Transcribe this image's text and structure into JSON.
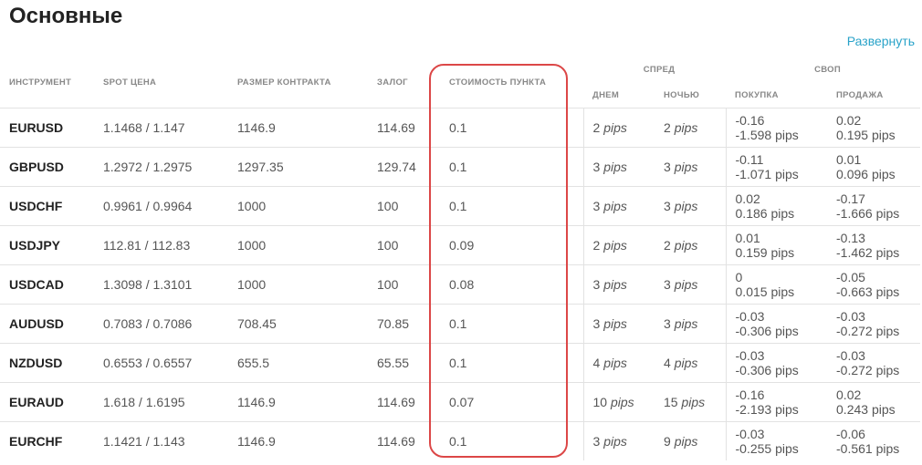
{
  "page": {
    "title": "Основные",
    "expand_link": "Развернуть"
  },
  "table": {
    "headers": {
      "instrument": "Инструмент",
      "spot": "Spot цена",
      "contract": "Размер контракта",
      "margin": "Залог",
      "point_cost": "Стоимость пункта",
      "spread": "Спред",
      "spread_day": "Днем",
      "spread_night": "Ночью",
      "swap": "Своп",
      "swap_buy": "Покупка",
      "swap_sell": "Продажа"
    },
    "rows": [
      {
        "symbol": "EURUSD",
        "spot": "1.1468 / 1.147",
        "contract": "1146.9",
        "margin": "114.69",
        "point": "0.1",
        "day": "2",
        "night": "2",
        "buy1": "-0.16",
        "buy2": "-1.598 pips",
        "sell1": "0.02",
        "sell2": "0.195 pips"
      },
      {
        "symbol": "GBPUSD",
        "spot": "1.2972 / 1.2975",
        "contract": "1297.35",
        "margin": "129.74",
        "point": "0.1",
        "day": "3",
        "night": "3",
        "buy1": "-0.11",
        "buy2": "-1.071 pips",
        "sell1": "0.01",
        "sell2": "0.096 pips"
      },
      {
        "symbol": "USDCHF",
        "spot": "0.9961 / 0.9964",
        "contract": "1000",
        "margin": "100",
        "point": "0.1",
        "day": "3",
        "night": "3",
        "buy1": "0.02",
        "buy2": "0.186 pips",
        "sell1": "-0.17",
        "sell2": "-1.666 pips"
      },
      {
        "symbol": "USDJPY",
        "spot": "112.81 / 112.83",
        "contract": "1000",
        "margin": "100",
        "point": "0.09",
        "day": "2",
        "night": "2",
        "buy1": "0.01",
        "buy2": "0.159 pips",
        "sell1": "-0.13",
        "sell2": "-1.462 pips"
      },
      {
        "symbol": "USDCAD",
        "spot": "1.3098 / 1.3101",
        "contract": "1000",
        "margin": "100",
        "point": "0.08",
        "day": "3",
        "night": "3",
        "buy1": "0",
        "buy2": "0.015 pips",
        "sell1": "-0.05",
        "sell2": "-0.663 pips"
      },
      {
        "symbol": "AUDUSD",
        "spot": "0.7083 / 0.7086",
        "contract": "708.45",
        "margin": "70.85",
        "point": "0.1",
        "day": "3",
        "night": "3",
        "buy1": "-0.03",
        "buy2": "-0.306 pips",
        "sell1": "-0.03",
        "sell2": "-0.272 pips"
      },
      {
        "symbol": "NZDUSD",
        "spot": "0.6553 / 0.6557",
        "contract": "655.5",
        "margin": "65.55",
        "point": "0.1",
        "day": "4",
        "night": "4",
        "buy1": "-0.03",
        "buy2": "-0.306 pips",
        "sell1": "-0.03",
        "sell2": "-0.272 pips"
      },
      {
        "symbol": "EURAUD",
        "spot": "1.618 / 1.6195",
        "contract": "1146.9",
        "margin": "114.69",
        "point": "0.07",
        "day": "10",
        "night": "15",
        "buy1": "-0.16",
        "buy2": "-2.193 pips",
        "sell1": "0.02",
        "sell2": "0.243 pips"
      },
      {
        "symbol": "EURCHF",
        "spot": "1.1421 / 1.143",
        "contract": "1146.9",
        "margin": "114.69",
        "point": "0.1",
        "day": "3",
        "night": "9",
        "buy1": "-0.03",
        "buy2": "-0.255 pips",
        "sell1": "-0.06",
        "sell2": "-0.561 pips"
      }
    ],
    "pips_unit": "pips"
  },
  "colors": {
    "accent_link": "#2aa3c9",
    "highlight_border": "#dc4747"
  }
}
